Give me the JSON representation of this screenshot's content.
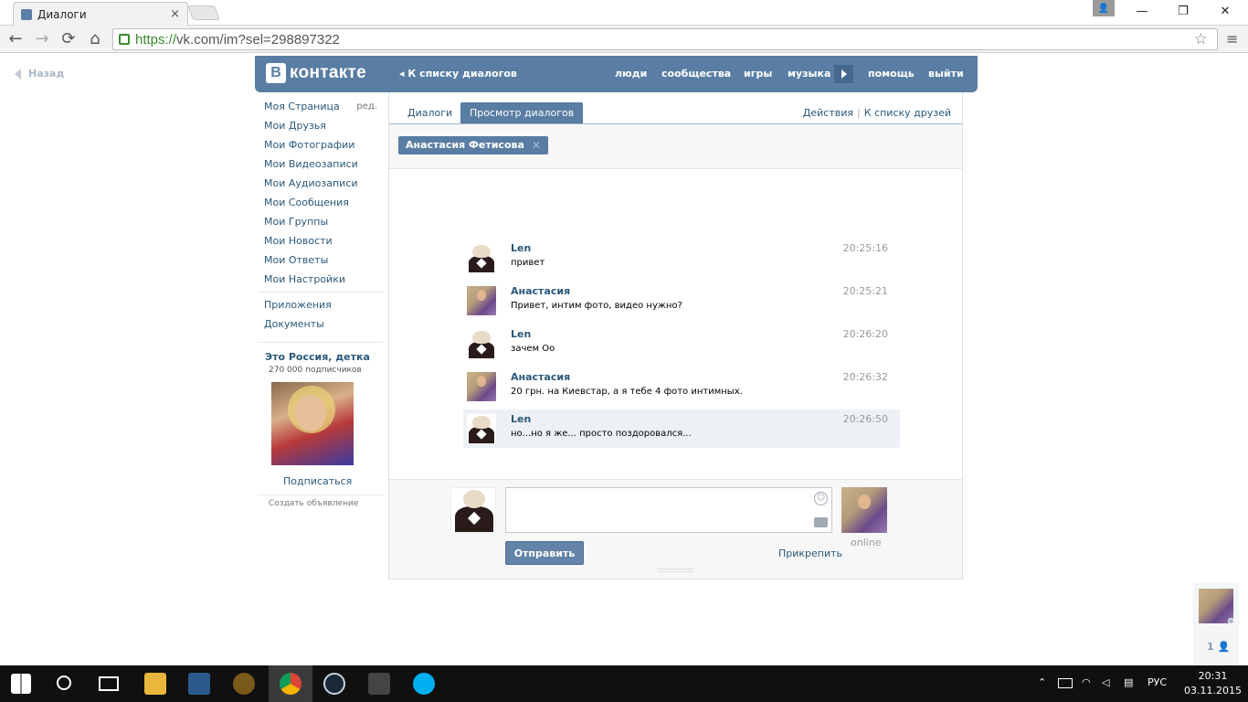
{
  "browser": {
    "tab_title": "Диалоги",
    "tab_close": "×",
    "url_scheme": "https://",
    "url_rest": "vk.com/im?sel=298897322",
    "nav_back": "←",
    "nav_forward": "→",
    "nav_reload": "⟳",
    "nav_home": "⌂",
    "star": "☆",
    "menu": "≡",
    "user": "👤",
    "minimize": "—",
    "restore": "❐",
    "close": "✕"
  },
  "page": {
    "back_label": "Назад"
  },
  "header": {
    "logo_letter": "В",
    "logo_text": "контакте",
    "back_to_list": "◂ К списку диалогов",
    "nav": [
      "люди",
      "сообщества",
      "игры",
      "музыка",
      "помощь",
      "выйти"
    ]
  },
  "left_menu": {
    "items": [
      "Моя Страница",
      "Мои Друзья",
      "Мои Фотографии",
      "Мои Видеозаписи",
      "Мои Аудиозаписи",
      "Мои Сообщения",
      "Мои Группы",
      "Мои Новости",
      "Мои Ответы",
      "Мои Настройки"
    ],
    "edit_label": "ред.",
    "extra_items": [
      "Приложения",
      "Документы"
    ],
    "public": {
      "title": "Это Россия, детка",
      "subscribers": "270 000 подписчиков",
      "subscribe_label": "Подписаться"
    },
    "ad_label": "Создать объявление"
  },
  "panel": {
    "tabs": [
      "Диалоги",
      "Просмотр диалогов"
    ],
    "actions": "Действия",
    "actions_sep": "|",
    "to_friends": "К списку друзей",
    "peer_chip": "Анастасия Фетисова",
    "peer_chip_close": "✕"
  },
  "messages": [
    {
      "name": "Len",
      "time": "20:25:16",
      "text": "привет",
      "avatar": "len"
    },
    {
      "name": "Анастасия",
      "time": "20:25:21",
      "text": "Привет, интим фото, видео нужно?",
      "avatar": "anastasia"
    },
    {
      "name": "Len",
      "time": "20:26:20",
      "text": "зачем Оо",
      "avatar": "len"
    },
    {
      "name": "Анастасия",
      "time": "20:26:32",
      "text": "20 грн. на Киевстар, а я тебе 4 фото интимных.",
      "avatar": "anastasia"
    },
    {
      "name": "Len",
      "time": "20:26:50",
      "text": "но...но я же... просто поздоровался...",
      "avatar": "len"
    }
  ],
  "composer": {
    "send_label": "Отправить",
    "attach_label": "Прикрепить",
    "peer_status": "online",
    "smile_icon": "☺"
  },
  "float_friend": {
    "count": "1 👤"
  },
  "taskbar": {
    "start_icon": "windows-logo-icon",
    "search_icon": "search-icon",
    "lang": "РУС",
    "time": "20:31",
    "date": "03.11.2015",
    "tray_up": "⌃",
    "notif": "▤"
  },
  "colors": {
    "vk_blue": "#597da3",
    "link": "#2b587a",
    "taskbar": "#101010"
  }
}
